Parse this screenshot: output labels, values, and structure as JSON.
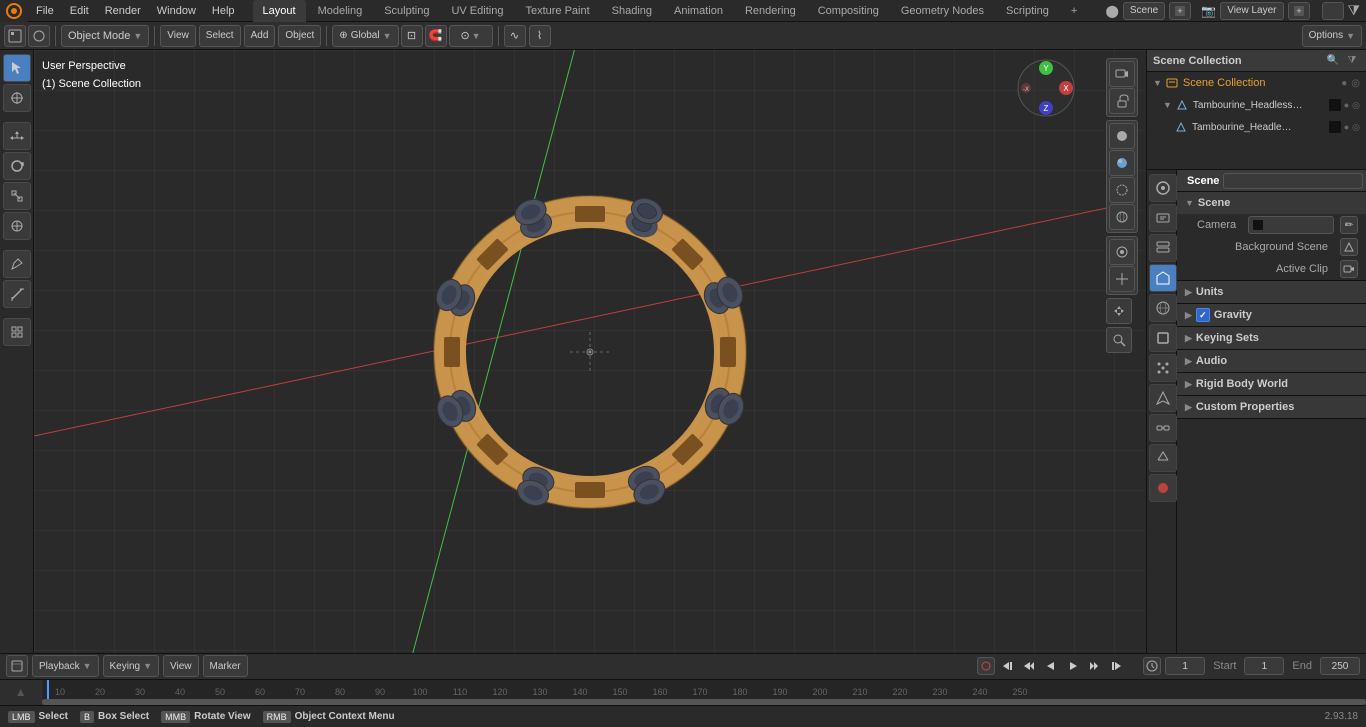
{
  "topMenu": {
    "items": [
      "File",
      "Edit",
      "Render",
      "Window",
      "Help"
    ],
    "workspaceTabs": [
      "Layout",
      "Modeling",
      "Sculpting",
      "UV Editing",
      "Texture Paint",
      "Shading",
      "Animation",
      "Rendering",
      "Compositing",
      "Geometry Nodes",
      "Scripting"
    ],
    "activeTab": "Layout",
    "addTabLabel": "+",
    "sceneLabel": "Scene",
    "viewLayerLabel": "View Layer",
    "optionsLabel": "Options"
  },
  "secondToolbar": {
    "modeLabel": "Object Mode",
    "viewLabel": "View",
    "selectLabel": "Select",
    "addLabel": "Add",
    "objectLabel": "Object",
    "globalLabel": "Global",
    "snapLabel": "Snap"
  },
  "viewport": {
    "perspLabel": "User Perspective",
    "collectionLabel": "(1) Scene Collection"
  },
  "outliner": {
    "title": "Scene Collection",
    "items": [
      {
        "name": "Tambourine_Headless_Double",
        "type": "mesh",
        "indent": 1,
        "expanded": true
      },
      {
        "name": "Tambourine_Headless_D",
        "type": "mesh",
        "indent": 2,
        "selected": false
      }
    ]
  },
  "properties": {
    "searchPlaceholder": "",
    "activeTab": "scene",
    "scene": {
      "title": "Scene",
      "sceneLabel": "Scene",
      "sections": {
        "scene": {
          "label": "Scene",
          "cameraLabel": "Camera",
          "cameraValue": "",
          "backgroundSceneLabel": "Background Scene",
          "activeClipLabel": "Active Clip"
        },
        "units": {
          "label": "Units"
        },
        "gravity": {
          "label": "Gravity",
          "checked": true
        },
        "keyingSets": {
          "label": "Keying Sets"
        },
        "audio": {
          "label": "Audio"
        },
        "rigidBodyWorld": {
          "label": "Rigid Body World"
        },
        "customProperties": {
          "label": "Custom Properties"
        }
      }
    }
  },
  "timeline": {
    "playbackLabel": "Playback",
    "keyingLabel": "Keying",
    "viewLabel": "View",
    "markerLabel": "Marker",
    "currentFrame": "1",
    "startFrame": "1",
    "endFrame": "250",
    "startLabel": "Start",
    "endLabel": "End",
    "frameNumbers": [
      "10",
      "20",
      "30",
      "40",
      "50",
      "60",
      "70",
      "80",
      "90",
      "100",
      "110",
      "120",
      "130",
      "140",
      "150",
      "160",
      "170",
      "180",
      "190",
      "200",
      "210",
      "220",
      "230",
      "240",
      "250"
    ]
  },
  "statusBar": {
    "selectLabel": "Select",
    "boxSelectLabel": "Box Select",
    "rotatViewLabel": "Rotate View",
    "contextMenuLabel": "Object Context Menu",
    "version": "2.93.18"
  },
  "icons": {
    "expand": "▶",
    "collapse": "▼",
    "mesh": "△",
    "scene": "🎬",
    "camera": "📷",
    "eye": "👁",
    "hide": "⊙",
    "check": "✓",
    "arrow_right": "▶",
    "arrow_down": "▼",
    "dot": "●",
    "circle": "○",
    "filter": "⧩",
    "plus": "+",
    "minus": "−",
    "refresh": "↺",
    "film": "🎞",
    "render": "⬤",
    "world": "⬤",
    "object": "⬤",
    "particles": "⬤",
    "physics": "⬤",
    "constraints": "⬤",
    "data": "⬤"
  }
}
